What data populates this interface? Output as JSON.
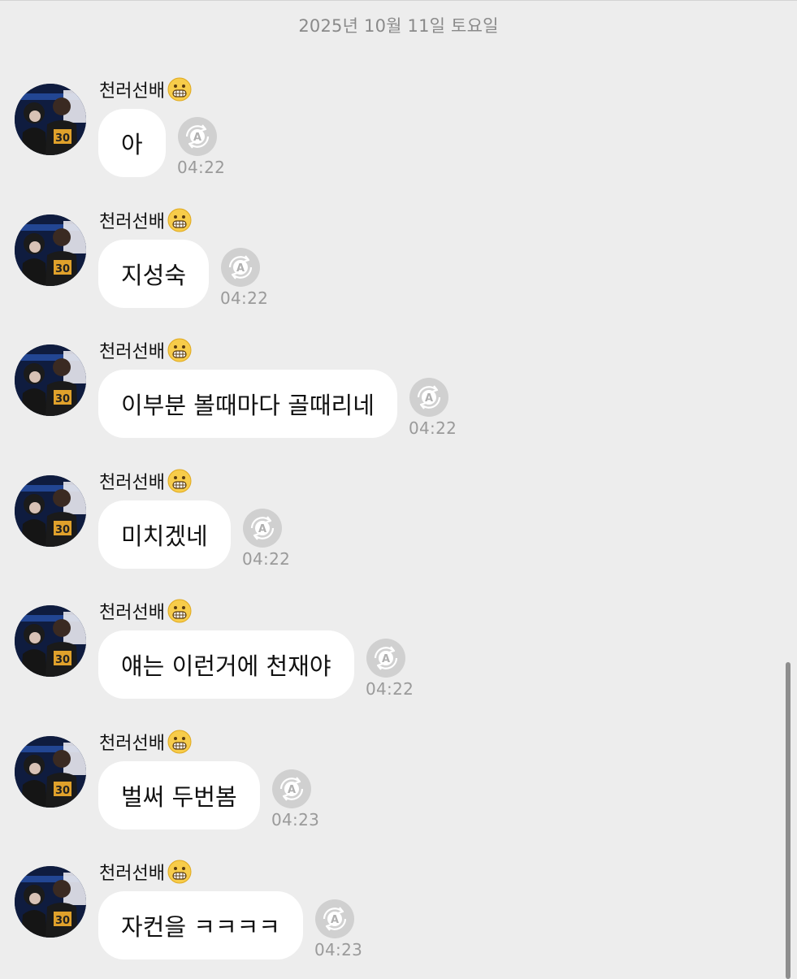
{
  "date_separator": "2025년 10월 11일 토요일",
  "messages": [
    {
      "sender": "천러선배",
      "text": "아",
      "time": "04:22"
    },
    {
      "sender": "천러선배",
      "text": "지성숙",
      "time": "04:22"
    },
    {
      "sender": "천러선배",
      "text": "이부분 볼때마다 골때리네",
      "time": "04:22"
    },
    {
      "sender": "천러선배",
      "text": "미치겠네",
      "time": "04:22"
    },
    {
      "sender": "천러선배",
      "text": "얘는 이런거에 천재야",
      "time": "04:22"
    },
    {
      "sender": "천러선배",
      "text": "벌써 두번봄",
      "time": "04:23"
    },
    {
      "sender": "천러선배",
      "text": "자컨을 ㅋㅋㅋㅋ",
      "time": "04:23"
    }
  ],
  "icons": {
    "sender_emoji": "grimacing-face-icon",
    "translate": "auto-translate-icon"
  },
  "colors": {
    "background": "#ededed",
    "bubble": "#ffffff",
    "timestamp": "#9a9a9a",
    "icon": "#b9b9b9"
  }
}
